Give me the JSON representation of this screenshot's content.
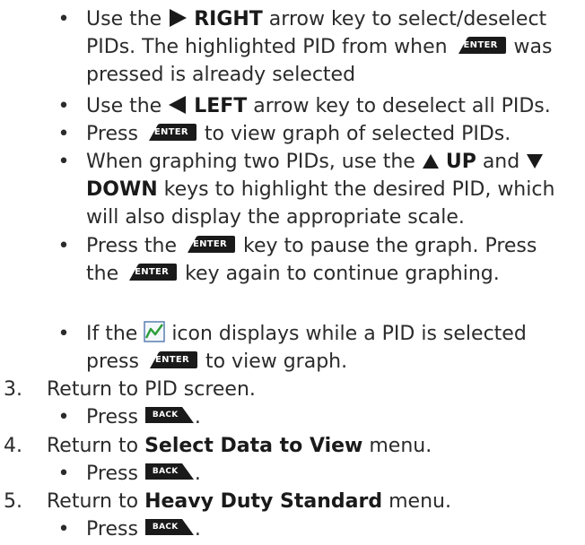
{
  "bullets": {
    "b1": {
      "line1_pre": "Use the ",
      "line1_key": "RIGHT",
      "line1_post": " arrow key to select/deselect",
      "line2_pre": "PIDs. The highlighted PID from when ",
      "line2_post": " was",
      "line3": "pressed is already selected"
    },
    "b2": {
      "pre": "Use the ",
      "key": "LEFT",
      "post": " arrow key to deselect all PIDs."
    },
    "b3": {
      "pre": "Press ",
      "post": " to view graph of selected PIDs."
    },
    "b4": {
      "line1_pre": "When graphing two PIDs, use the ",
      "line1_up": "UP",
      "line1_mid": " and ",
      "line2_key": "DOWN",
      "line2_post": " keys to highlight the desired PID, which",
      "line3": "will also display the appropriate scale."
    },
    "b5": {
      "line1_pre": "Press the ",
      "line1_post": " key to pause the graph. Press",
      "line2_pre": "the ",
      "line2_post": " key again to continue graphing."
    },
    "b6": {
      "line1_pre": "If the ",
      "line1_post": " icon displays while a PID is selected",
      "line2_pre": "press ",
      "line2_post": " to view graph."
    }
  },
  "steps": [
    {
      "num": "3.",
      "pre": "Return to PID screen.",
      "bold": "",
      "post": "",
      "sub_pre": "Press "
    },
    {
      "num": "4.",
      "pre": "Return to ",
      "bold": "Select Data to View",
      "post": " menu.",
      "sub_pre": "Press "
    },
    {
      "num": "5.",
      "pre": "Return to ",
      "bold": "Heavy Duty Standard",
      "post": " menu.",
      "sub_pre": "Press "
    }
  ],
  "keys": {
    "enter_label": "ENTER",
    "back_label": "BACK"
  },
  "bullet_glyph": "•",
  "sub_bullet_glyph": "•",
  "colors": {
    "text": "#2b2b2b",
    "key_fill": "#1a1a1a",
    "graph_icon_line": "#2e9e3a",
    "graph_icon_border": "#5a7fb0"
  }
}
